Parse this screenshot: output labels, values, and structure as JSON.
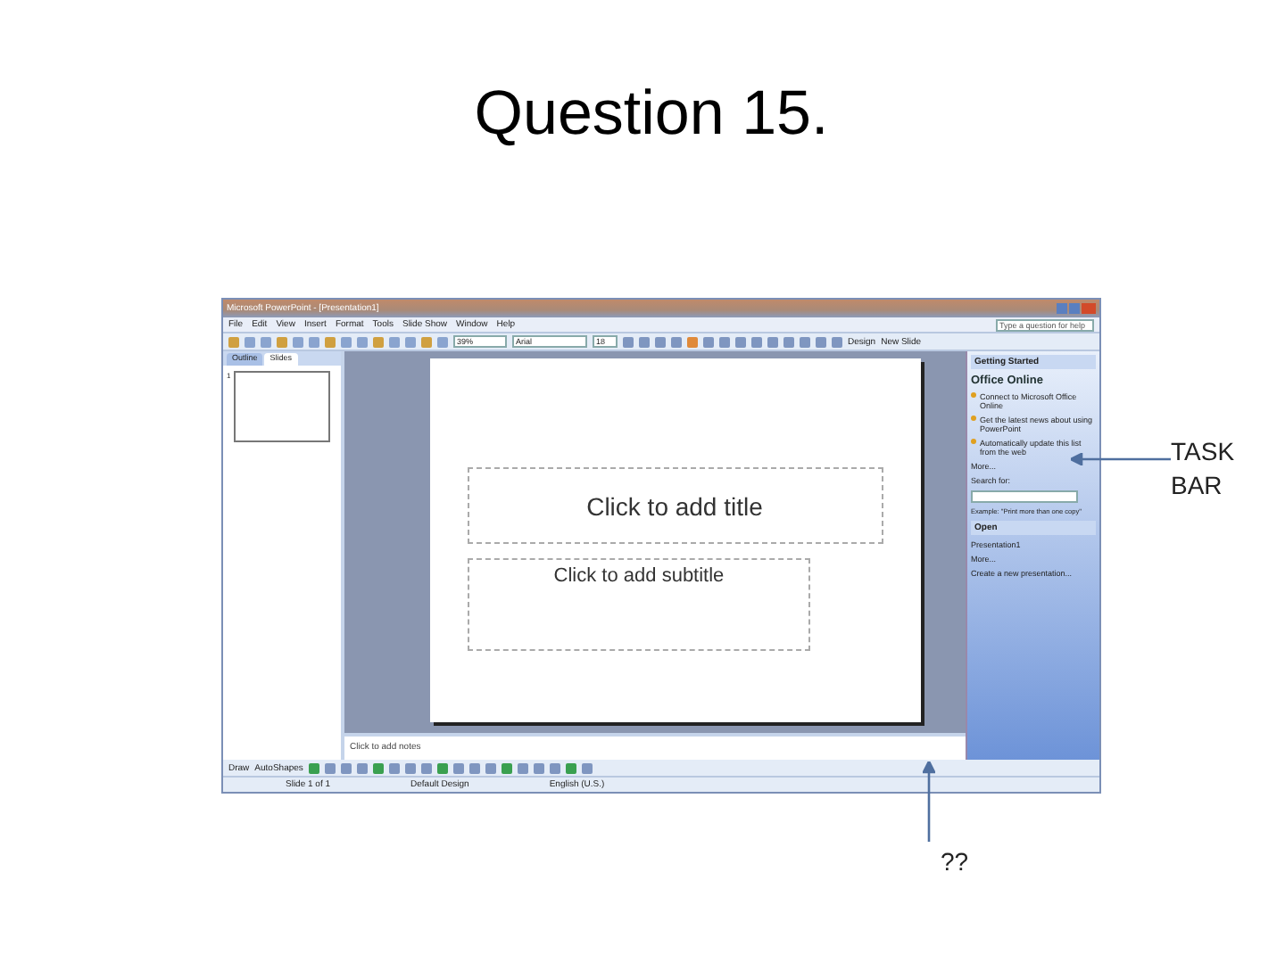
{
  "slide_title": "Question 15.",
  "window": {
    "title": "Microsoft PowerPoint - [Presentation1]",
    "menu": [
      "File",
      "Edit",
      "View",
      "Insert",
      "Format",
      "Tools",
      "Slide Show",
      "Window",
      "Help"
    ],
    "help_box": {
      "placeholder": "Type a question for help"
    },
    "toolbar": {
      "zoom": "39%",
      "font": "Arial",
      "size": "18",
      "design": "Design",
      "new_slide": "New Slide"
    },
    "pane_tabs": [
      {
        "label": "Outline",
        "selected": false
      },
      {
        "label": "Slides",
        "selected": true
      }
    ],
    "slide_number": "1",
    "slide": {
      "title": "Click to add title",
      "subtitle": "Click to add subtitle"
    },
    "notes": {
      "placeholder": "Click to add notes"
    },
    "task_pane": {
      "title": "Getting Started",
      "brand": "Office Online",
      "links": [
        "Connect to Microsoft Office Online",
        "Get the latest news about using PowerPoint",
        "Automatically update this list from the web"
      ],
      "more": "More...",
      "search_label": "Search for:",
      "search_example": "Example: \"Print more than one copy\"",
      "open_heading": "Open",
      "open_items": [
        "Presentation1",
        "More..."
      ],
      "create": "Create a new presentation..."
    },
    "draw_toolbar": {
      "draw": "Draw",
      "autoshapes": "AutoShapes"
    },
    "status_bar": [
      "Slide 1 of 1",
      "Default Design",
      "English (U.S.)"
    ]
  },
  "annotations": [
    {
      "kind": "right",
      "label": "TASK BAR"
    },
    {
      "kind": "below",
      "label": "??"
    }
  ]
}
